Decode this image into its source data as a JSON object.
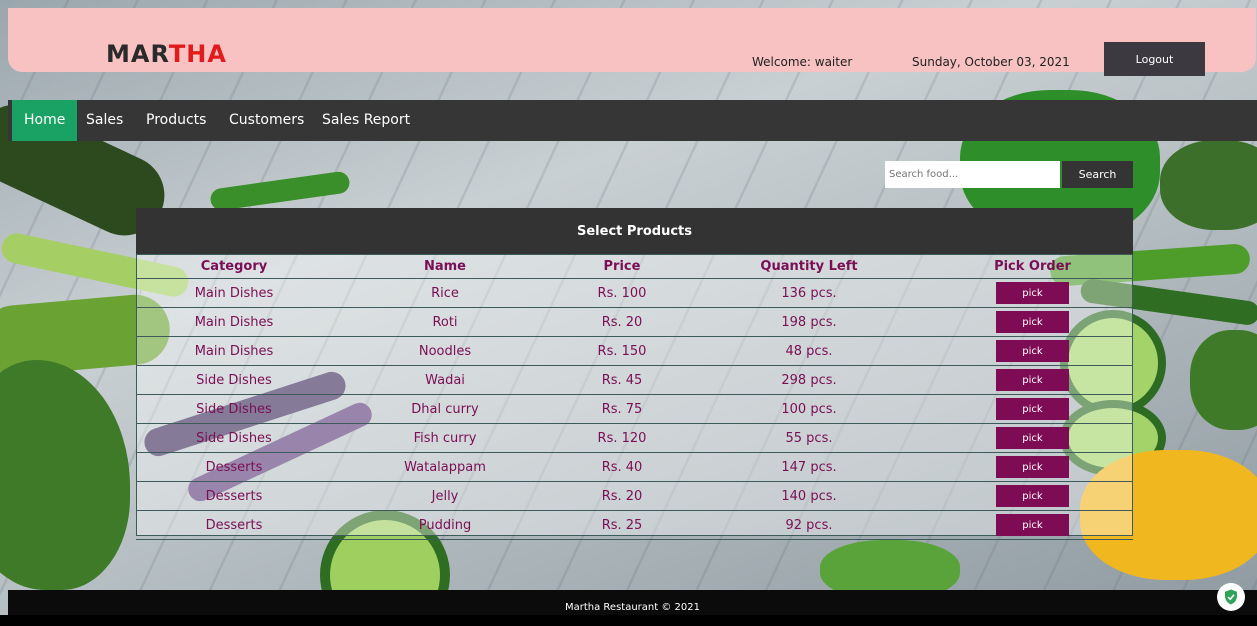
{
  "header": {
    "logo_part1": "MAR",
    "logo_part2": "THA",
    "welcome": "Welcome: waiter",
    "date": "Sunday, October 03, 2021",
    "logout_label": "Logout"
  },
  "nav": {
    "items": [
      {
        "label": "Home",
        "active": true
      },
      {
        "label": "Sales",
        "active": false
      },
      {
        "label": "Products",
        "active": false
      },
      {
        "label": "Customers",
        "active": false
      },
      {
        "label": "Sales Report",
        "active": false
      }
    ]
  },
  "search": {
    "placeholder": "Search food...",
    "button_label": "Search"
  },
  "products": {
    "title": "Select Products",
    "columns": [
      "Category",
      "Name",
      "Price",
      "Quantity Left",
      "Pick Order"
    ],
    "pick_label": "pick",
    "rows": [
      {
        "category": "Main Dishes",
        "name": "Rice",
        "price": "Rs. 100",
        "qty": "136 pcs."
      },
      {
        "category": "Main Dishes",
        "name": "Roti",
        "price": "Rs. 20",
        "qty": "198 pcs."
      },
      {
        "category": "Main Dishes",
        "name": "Noodles",
        "price": "Rs. 150",
        "qty": "48 pcs."
      },
      {
        "category": "Side Dishes",
        "name": "Wadai",
        "price": "Rs. 45",
        "qty": "298 pcs."
      },
      {
        "category": "Side Dishes",
        "name": "Dhal curry",
        "price": "Rs. 75",
        "qty": "100 pcs."
      },
      {
        "category": "Side Dishes",
        "name": "Fish curry",
        "price": "Rs. 120",
        "qty": "55 pcs."
      },
      {
        "category": "Desserts",
        "name": "Watalappam",
        "price": "Rs. 40",
        "qty": "147 pcs."
      },
      {
        "category": "Desserts",
        "name": "Jelly",
        "price": "Rs. 20",
        "qty": "140 pcs."
      },
      {
        "category": "Desserts",
        "name": "Pudding",
        "price": "Rs. 25",
        "qty": "92 pcs."
      }
    ]
  },
  "footer": {
    "text": "Martha Restaurant © 2021"
  },
  "colors": {
    "header_bg": "#f8c2c2",
    "nav_active": "#1aa264",
    "pick_button": "#7e0c55",
    "table_text": "#7a0f55"
  }
}
